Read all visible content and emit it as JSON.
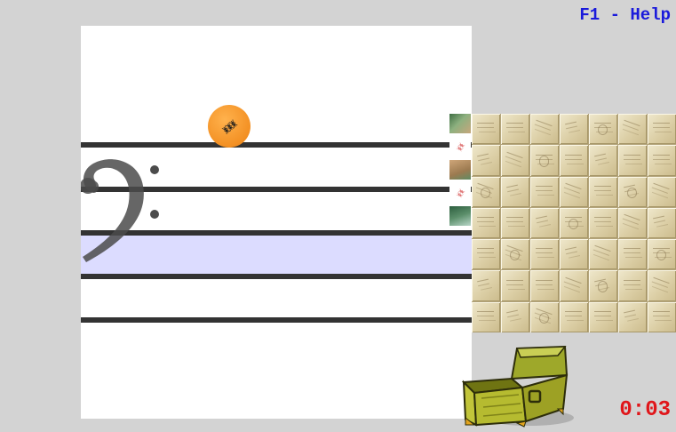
{
  "hud": {
    "help_label": "F1 - Help",
    "timer": "0:03"
  },
  "game": {
    "clef": "bass-clef-icon",
    "note_ball": {
      "icon": "note-name-glyph-icon",
      "color": "#f39023"
    },
    "highlight_color": "#dcdcff",
    "staff_line_count": 5,
    "reward": "treasure-chest-icon"
  },
  "puzzle": {
    "tile_rows": 7,
    "tile_cols": 7,
    "tile_color": "#dccfa6",
    "thumbnail_count": 5
  },
  "colors": {
    "background": "#d3d3d3",
    "help_text": "#1a1adb",
    "timer_text": "#e0161a",
    "staff_line": "#333333"
  }
}
